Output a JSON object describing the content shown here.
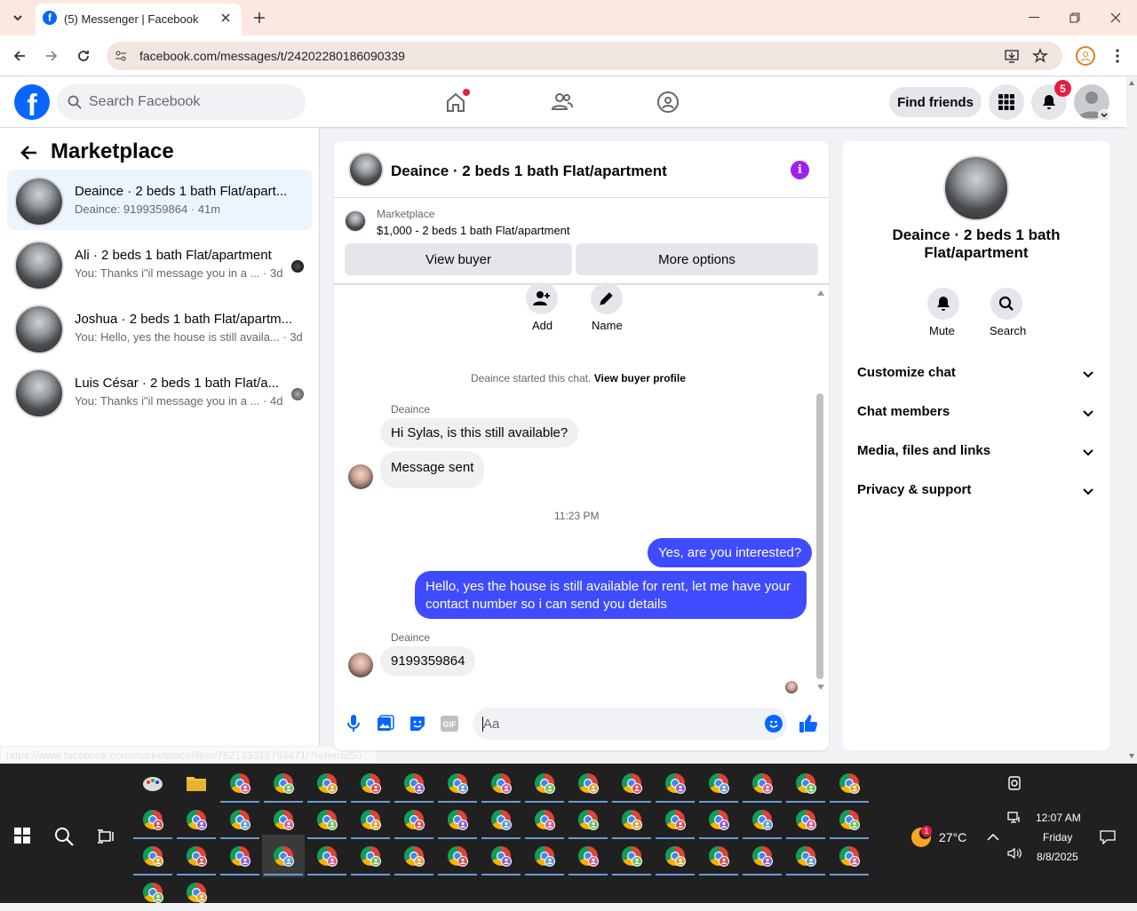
{
  "browser": {
    "tab_title": "(5) Messenger | Facebook",
    "url": "facebook.com/messages/t/24202280186090339",
    "status_url": "https://www.facebook.com/marketplace/item/762133316764471/?referralSu..."
  },
  "fbnav": {
    "search_placeholder": "Search Facebook",
    "find_friends": "Find friends",
    "notifications_count": "5"
  },
  "left": {
    "title": "Marketplace",
    "conversations": [
      {
        "name": "Deaince · 2 beds 1 bath Flat/apart...",
        "preview": "Deaince: 9199359864",
        "time": "41m"
      },
      {
        "name": "Ali · 2 beds 1 bath Flat/apartment",
        "preview": "You: Thanks i\"il message you in a ...",
        "time": "3d"
      },
      {
        "name": "Joshua · 2 beds 1 bath Flat/apartm...",
        "preview": "You: Hello, yes the house is still availa...",
        "time": "3d"
      },
      {
        "name": "Luis César · 2 beds 1 bath Flat/a...",
        "preview": "You: Thanks i\"il message you in a ...",
        "time": "4d"
      }
    ]
  },
  "chat": {
    "header_title": "Deaince · 2 beds 1 bath Flat/apartment",
    "listing_label": "Marketplace",
    "listing_price": "$1,000 - 2 beds 1 bath Flat/apartment",
    "view_buyer": "View buyer",
    "more_options": "More options",
    "add_label": "Add",
    "name_label": "Name",
    "started_text": "Deaince started this chat.",
    "view_buyer_profile": "View buyer profile",
    "sender_name_1": "Deaince",
    "msg_in_1": "Hi Sylas, is this still available?",
    "msg_in_2": "Message sent",
    "timestamp": "11:23 PM",
    "msg_out_1": "Yes, are you interested?",
    "msg_out_2": "Hello, yes the house is still available for rent, let me have your contact number so i can send you details",
    "sender_name_2": "Deaince",
    "msg_in_3": "9199359864",
    "composer_placeholder": "Aa"
  },
  "right": {
    "title": "Deaince · 2 beds 1 bath Flat/apartment",
    "mute": "Mute",
    "search": "Search",
    "sections": [
      "Customize chat",
      "Chat members",
      "Media, files and links",
      "Privacy & support"
    ]
  },
  "taskbar": {
    "weather": "27°C",
    "weather_badge": "1",
    "time": "12:07 AM",
    "day": "Friday",
    "date": "8/8/2025"
  },
  "colors": {
    "fb_blue": "#0866ff",
    "outgoing_bubble": "#3e4bff",
    "notification_red": "#e41e3f",
    "info_purple": "#a020f0"
  }
}
